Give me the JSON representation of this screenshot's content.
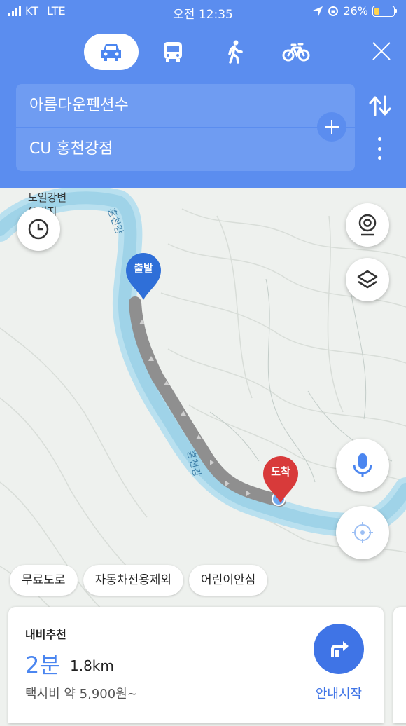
{
  "status": {
    "carrier": "KT",
    "network": "LTE",
    "time": "오전 12:35",
    "battery": "26%",
    "battery_level": 0.26
  },
  "modes": [
    {
      "name": "car-icon",
      "active": true
    },
    {
      "name": "bus-icon",
      "active": false
    },
    {
      "name": "walk-icon",
      "active": false
    },
    {
      "name": "bike-icon",
      "active": false
    }
  ],
  "route": {
    "origin": "아름다운펜션수",
    "destination": "CU 홍천강점"
  },
  "map": {
    "place_label_1": "노일강변",
    "place_label_2": "유원지",
    "river_label_1": "홍천강",
    "river_label_2": "홍천강",
    "start_pin": "출발",
    "end_pin": "도착",
    "start_color": "#2f6fd8",
    "end_color": "#d83a3a",
    "route_color": "#8f8f8f",
    "river_color": "#9fd3e8"
  },
  "chips": [
    "무료도로",
    "자동차전용제외",
    "어린이안심"
  ],
  "card": {
    "title": "내비추천",
    "time": "2분",
    "distance": "1.8km",
    "fare": "택시비 약 5,900원~",
    "start_label": "안내시작"
  },
  "colors": {
    "header": "#5b8def",
    "accent": "#3f74e6"
  }
}
